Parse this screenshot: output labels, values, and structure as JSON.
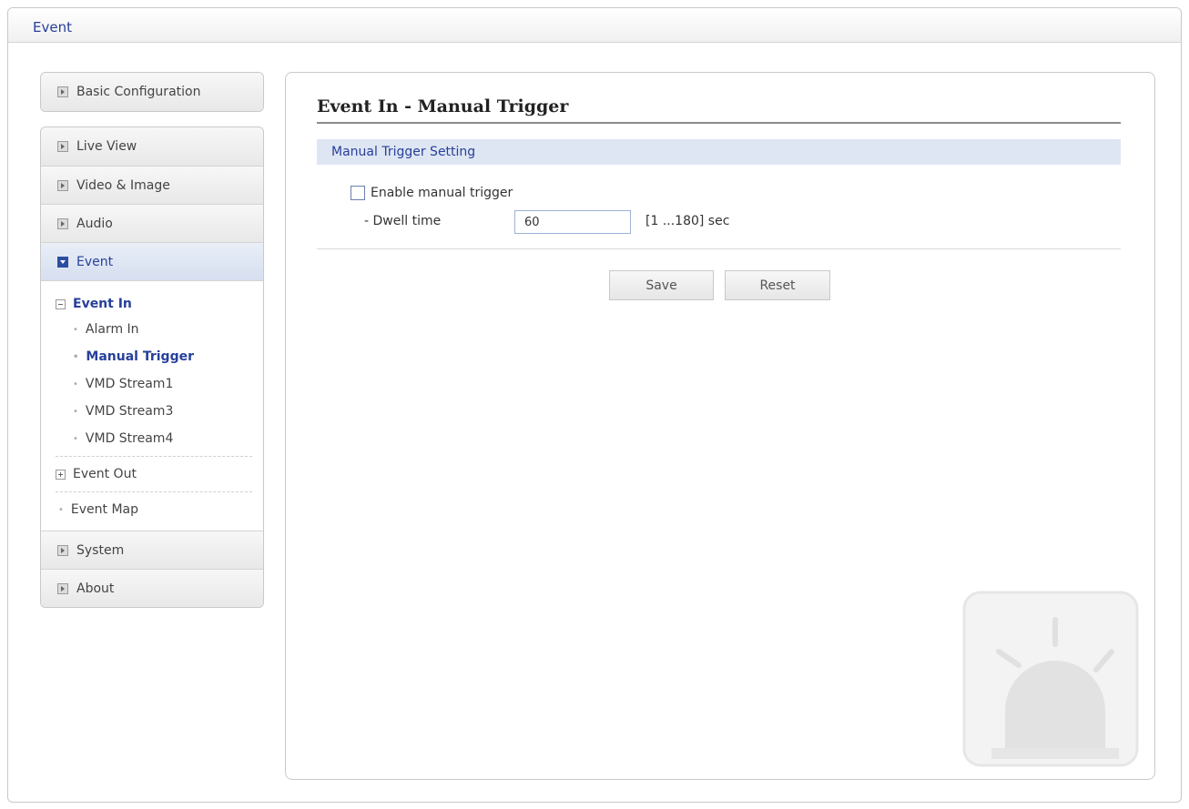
{
  "window": {
    "title": "Event"
  },
  "sidebar": {
    "top_item": "Basic Configuration",
    "items": [
      {
        "label": "Live View"
      },
      {
        "label": "Video & Image"
      },
      {
        "label": "Audio"
      },
      {
        "label": "Event"
      }
    ],
    "event_tree": {
      "event_in": "Event In",
      "children": [
        "Alarm In",
        "Manual Trigger",
        "VMD Stream1",
        "VMD Stream3",
        "VMD Stream4"
      ],
      "event_out": "Event Out",
      "event_map": "Event Map"
    },
    "bottom_items": [
      {
        "label": "System"
      },
      {
        "label": "About"
      }
    ]
  },
  "main": {
    "title": "Event In - Manual Trigger",
    "section": "Manual Trigger Setting",
    "enable_label": "Enable manual trigger",
    "enable_checked": false,
    "dwell_label": "- Dwell time",
    "dwell_value": "60",
    "dwell_range": "[1 ...180] sec",
    "save_label": "Save",
    "reset_label": "Reset"
  },
  "colors": {
    "accent": "#27409a",
    "section_bg": "#dfe6f3",
    "active_bg": "#d6dff0"
  },
  "icons": {
    "expand": "triangle-right-icon",
    "expanded": "triangle-down-icon",
    "tree_collapse": "minus-box-icon",
    "tree_expand": "plus-box-icon",
    "watermark": "alarm-light-icon"
  }
}
